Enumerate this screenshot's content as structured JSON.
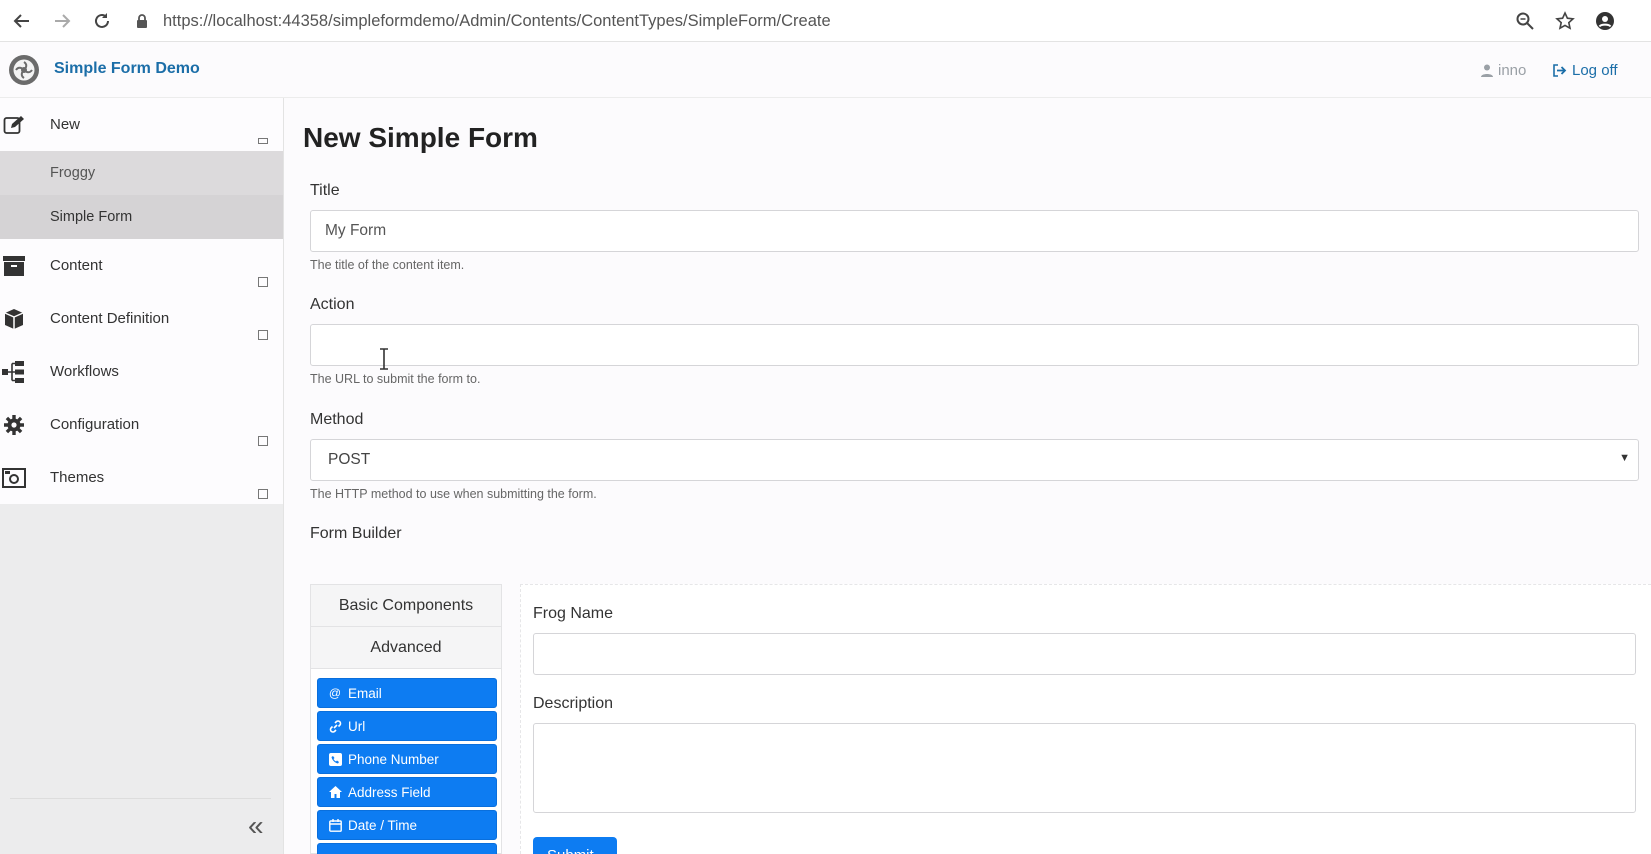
{
  "browser": {
    "url": "https://localhost:44358/simpleformdemo/Admin/Contents/ContentTypes/SimpleForm/Create",
    "icons": [
      "back-icon",
      "forward-icon",
      "reload-icon",
      "lock-icon",
      "zoom-icon",
      "star-icon",
      "account-icon"
    ]
  },
  "header": {
    "brand": "Simple Form Demo",
    "user": "inno",
    "logoff": "Log off"
  },
  "sidebar": {
    "items": [
      {
        "label": "New",
        "icon": "edit-icon"
      },
      {
        "label": "Content",
        "icon": "archive-icon"
      },
      {
        "label": "Content Definition",
        "icon": "cube-icon"
      },
      {
        "label": "Workflows",
        "icon": "sitemap-icon"
      },
      {
        "label": "Configuration",
        "icon": "gear-icon"
      },
      {
        "label": "Themes",
        "icon": "image-icon"
      }
    ],
    "sub_items": [
      "Froggy",
      "Simple Form"
    ],
    "collapse": "«"
  },
  "main": {
    "title": "New Simple Form",
    "fields": {
      "title": {
        "label": "Title",
        "value": "My Form",
        "help": "The title of the content item."
      },
      "action": {
        "label": "Action",
        "value": "",
        "help": "The URL to submit the form to."
      },
      "method": {
        "label": "Method",
        "value": "POST",
        "help": "The HTTP method to use when submitting the form."
      }
    },
    "form_builder": {
      "label": "Form Builder",
      "tabs": [
        "Basic Components",
        "Advanced"
      ],
      "components": [
        {
          "label": "Email",
          "icon": "at-icon"
        },
        {
          "label": "Url",
          "icon": "link-icon"
        },
        {
          "label": "Phone Number",
          "icon": "phone-icon"
        },
        {
          "label": "Address Field",
          "icon": "home-icon"
        },
        {
          "label": "Date / Time",
          "icon": "calendar-icon"
        }
      ],
      "preview": {
        "frog_name_label": "Frog Name",
        "description_label": "Description",
        "submit": "Submit"
      }
    }
  },
  "colors": {
    "brand": "#1b6ea8",
    "button": "#0d7cf2"
  }
}
